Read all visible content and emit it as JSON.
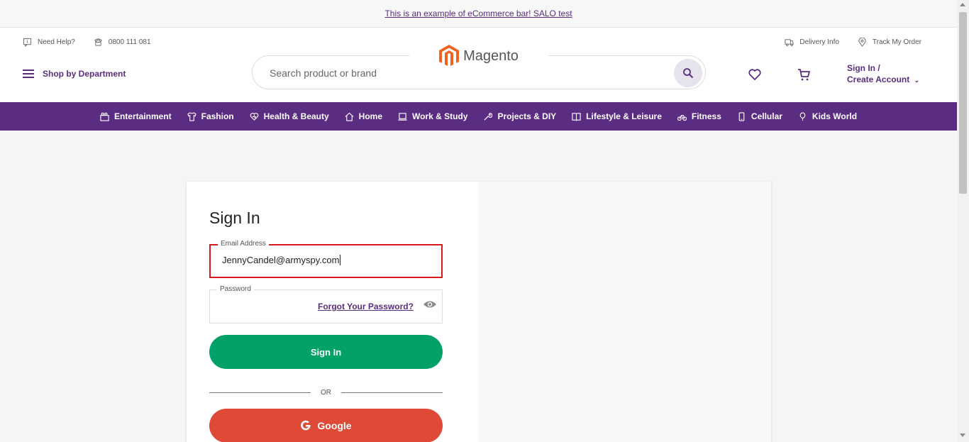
{
  "promo": {
    "text": "This is an example of eCommerce bar! SALO test"
  },
  "utility": {
    "need_help": "Need Help?",
    "phone": "0800 111 081",
    "delivery_info": "Delivery Info",
    "track_order": "Track My Order"
  },
  "header": {
    "shop_by_department": "Shop by Department",
    "logo_text": "Magento",
    "search_placeholder": "Search product or brand",
    "account_line1": "Sign In /",
    "account_line2": "Create Account"
  },
  "nav": {
    "items": [
      {
        "label": "Entertainment",
        "icon": "entertainment-icon"
      },
      {
        "label": "Fashion",
        "icon": "shirt-icon"
      },
      {
        "label": "Health & Beauty",
        "icon": "heart-icon"
      },
      {
        "label": "Home",
        "icon": "home-icon"
      },
      {
        "label": "Work & Study",
        "icon": "laptop-icon"
      },
      {
        "label": "Projects & DIY",
        "icon": "wrench-icon"
      },
      {
        "label": "Lifestyle & Leisure",
        "icon": "book-icon"
      },
      {
        "label": "Fitness",
        "icon": "bicycle-icon"
      },
      {
        "label": "Cellular",
        "icon": "phone-icon"
      },
      {
        "label": "Kids World",
        "icon": "balloon-icon"
      }
    ]
  },
  "signin": {
    "title": "Sign In",
    "email_label": "Email Address",
    "email_value": "JennyCandel@armyspy.com",
    "password_label": "Password",
    "forgot_password": "Forgot Your Password?",
    "signin_button": "Sign In",
    "or_text": "OR",
    "google_button": "Google"
  },
  "colors": {
    "brand_purple": "#5a2d82",
    "signin_green": "#02a167",
    "google_red": "#df4a37",
    "error_red": "#d8181f",
    "logo_orange": "#f26322"
  }
}
